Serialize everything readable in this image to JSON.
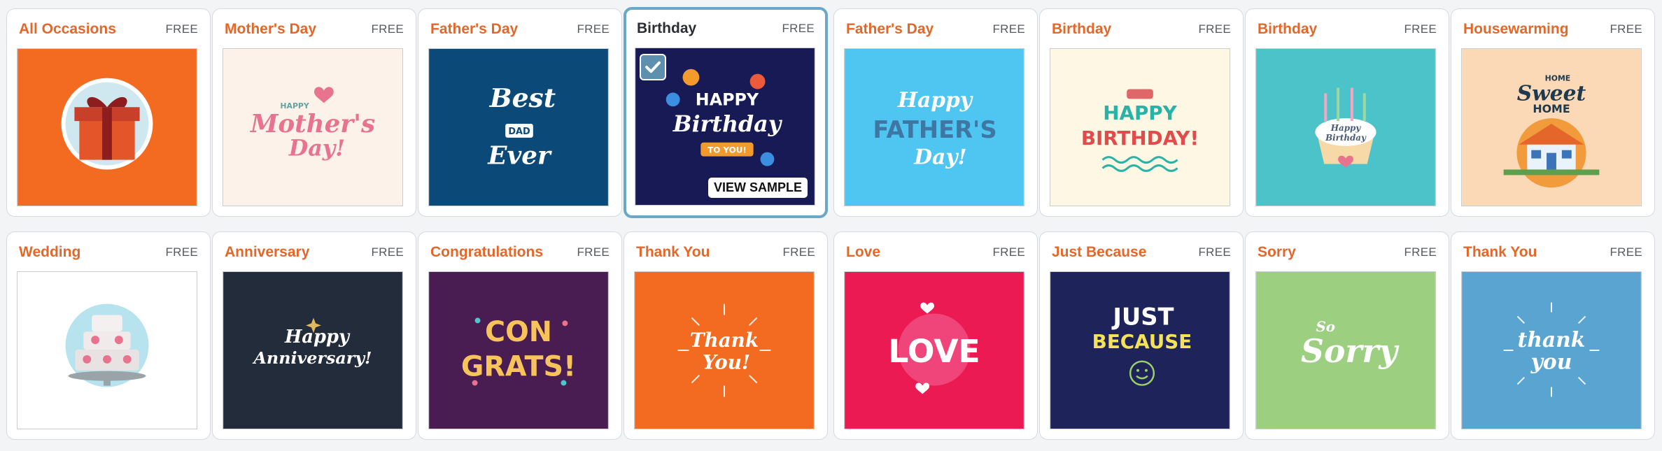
{
  "cards": [
    {
      "title": "All Occasions",
      "price": "FREE"
    },
    {
      "title": "Mother's Day",
      "price": "FREE"
    },
    {
      "title": "Father's Day",
      "price": "FREE"
    },
    {
      "title": "Birthday",
      "price": "FREE",
      "selected": true,
      "view_sample": "VIEW SAMPLE"
    },
    {
      "title": "Father's Day",
      "price": "FREE"
    },
    {
      "title": "Birthday",
      "price": "FREE"
    },
    {
      "title": "Birthday",
      "price": "FREE"
    },
    {
      "title": "Housewarming",
      "price": "FREE"
    },
    {
      "title": "Wedding",
      "price": "FREE"
    },
    {
      "title": "Anniversary",
      "price": "FREE"
    },
    {
      "title": "Congratulations",
      "price": "FREE"
    },
    {
      "title": "Thank You",
      "price": "FREE"
    },
    {
      "title": "Love",
      "price": "FREE"
    },
    {
      "title": "Just Because",
      "price": "FREE"
    },
    {
      "title": "Sorry",
      "price": "FREE"
    },
    {
      "title": "Thank You",
      "price": "FREE"
    }
  ],
  "art": {
    "mothers_day": [
      "HAPPY",
      "Mother's",
      "Day!"
    ],
    "fathers_day_1": [
      "Best",
      "DAD",
      "Ever"
    ],
    "birthday_1": [
      "HAPPY",
      "Birthday",
      "TO YOU!"
    ],
    "fathers_day_2": [
      "Happy",
      "FATHER'S",
      "Day!"
    ],
    "birthday_2": [
      "HAPPY",
      "BIRTHDAY!"
    ],
    "birthday_3": [
      "Happy",
      "Birthday"
    ],
    "housewarming": [
      "HOME",
      "Sweet",
      "HOME"
    ],
    "anniversary": [
      "Happy",
      "Anniversary!"
    ],
    "congrats": [
      "CON",
      "GRATS!"
    ],
    "thank_you_1": [
      "Thank",
      "You!"
    ],
    "love": [
      "LOVE"
    ],
    "just_because": [
      "JUST",
      "BECAUSE"
    ],
    "sorry": [
      "So",
      "Sorry"
    ],
    "thank_you_2": [
      "thank",
      "you"
    ]
  },
  "colors": {
    "accent": "#e4672a",
    "selected_border": "#6aa7c8",
    "checkbox": "#5d8fae"
  }
}
